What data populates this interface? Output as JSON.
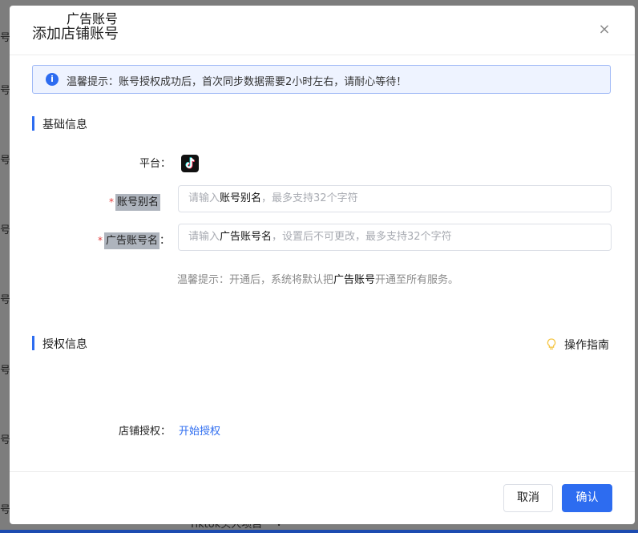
{
  "background": {
    "row_glyph": "号",
    "bottom_text": "Tiktok头人项目",
    "bottom_chevron": "∨"
  },
  "overlay_label": "广告账号",
  "modal": {
    "title": "添加店铺账号",
    "close_icon": "×"
  },
  "alert": {
    "icon": "i",
    "text": "温馨提示：账号授权成功后，首次同步数据需要2小时左右，请耐心等待！"
  },
  "basic_section": {
    "title": "基础信息",
    "platform_label": "平台：",
    "platform_icon": "tiktok-logo",
    "alias": {
      "required_mark": "*",
      "label": "账号别名",
      "placeholder_pre": "请输入",
      "placeholder_bold": "账号别名",
      "placeholder_post": "，最多支持32个字符"
    },
    "ad_account": {
      "required_mark": "*",
      "label": "广告账号名",
      "label_suffix": "：",
      "placeholder_pre": "请输入",
      "placeholder_bold": "广告账号名",
      "placeholder_post": "，设置后不可更改，最多支持32个字符"
    },
    "hint_pre": "温馨提示：开通后，系统将默认把",
    "hint_bold": "广告账号",
    "hint_post": "开通至所有服务。"
  },
  "auth_section": {
    "title": "授权信息",
    "guide_label": "操作指南",
    "shop_auth_label": "店铺授权：",
    "start_auth_link": "开始授权"
  },
  "footer": {
    "cancel_label": "取消",
    "confirm_label": "确认"
  },
  "colors": {
    "primary": "#2d6cf0",
    "required": "#e23b3b",
    "alert_bg": "#eef3ff"
  }
}
